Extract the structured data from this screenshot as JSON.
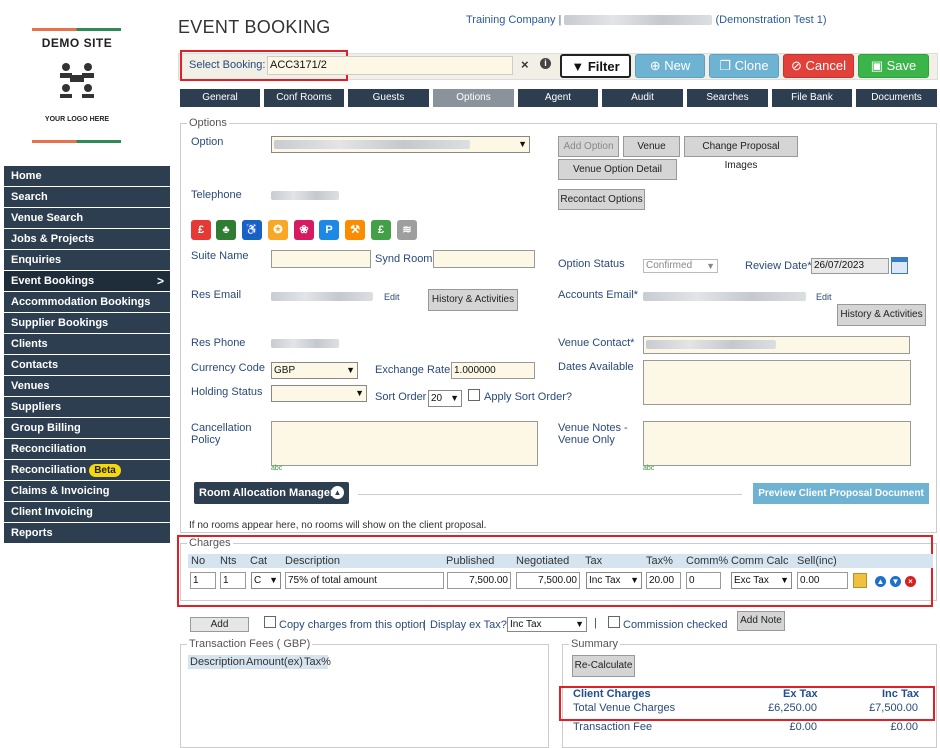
{
  "logo": {
    "site_name": "DEMO SITE",
    "tagline": "YOUR LOGO HERE"
  },
  "sidebar": {
    "items": [
      {
        "label": "Home"
      },
      {
        "label": "Search"
      },
      {
        "label": "Venue Search"
      },
      {
        "label": "Jobs & Projects"
      },
      {
        "label": "Enquiries"
      },
      {
        "label": "Event Bookings"
      },
      {
        "label": "Accommodation Bookings"
      },
      {
        "label": "Supplier Bookings"
      },
      {
        "label": "Clients"
      },
      {
        "label": "Contacts"
      },
      {
        "label": "Venues"
      },
      {
        "label": "Suppliers"
      },
      {
        "label": "Group Billing"
      },
      {
        "label": "Reconciliation"
      },
      {
        "label": "Reconciliation"
      },
      {
        "label": "Claims & Invoicing"
      },
      {
        "label": "Client Invoicing"
      },
      {
        "label": "Reports"
      }
    ],
    "beta_badge": "Beta",
    "active_chevron": ">"
  },
  "header": {
    "title": "EVENT BOOKING",
    "company_prefix": "Training Company |",
    "company_suffix": "(Demonstration Test 1)"
  },
  "booking_bar": {
    "select_label": "Select Booking:",
    "booking_ref": "ACC3171/2",
    "clear_symbol": "×",
    "info_symbol": "i",
    "filter_label": "Filter",
    "new_label": "New",
    "clone_label": "Clone",
    "cancel_label": "Cancel",
    "save_label": "Save"
  },
  "tabs": [
    {
      "label": "General"
    },
    {
      "label": "Conf Rooms"
    },
    {
      "label": "Guests"
    },
    {
      "label": "Options"
    },
    {
      "label": "Agent"
    },
    {
      "label": "Audit"
    },
    {
      "label": "Searches"
    },
    {
      "label": "File Bank"
    },
    {
      "label": "Documents"
    }
  ],
  "options": {
    "legend": "Options",
    "option_label": "Option",
    "telephone_label": "Telephone",
    "suite_name_label": "Suite Name",
    "synd_room_label": "Synd Room",
    "res_email_label": "Res Email",
    "edit_label": "Edit",
    "history_label": "History & Activities",
    "res_phone_label": "Res Phone",
    "currency_code_label": "Currency Code",
    "currency_code_value": "GBP",
    "exchange_rate_label": "Exchange Rate",
    "exchange_rate_value": "1.000000",
    "holding_status_label": "Holding Status",
    "sort_order_label": "Sort Order",
    "sort_order_value": "20",
    "apply_sort_label": "Apply Sort Order?",
    "cancellation_policy_label": "Cancellation Policy",
    "add_option_label": "Add Option",
    "venue_label": "Venue",
    "change_images_label": "Change Proposal Images",
    "venue_option_detail_label": "Venue Option Detail",
    "recontact_label": "Recontact Options",
    "option_status_label": "Option Status",
    "option_status_value": "Confirmed",
    "review_date_label": "Review Date*",
    "review_date_value": "26/07/2023",
    "accounts_email_label": "Accounts Email*",
    "venue_contact_label": "Venue Contact*",
    "dates_available_label": "Dates Available",
    "venue_notes_label": "Venue Notes - Venue Only",
    "spell_mark": "abc",
    "room_alloc_label": "Room Allocation Manager",
    "preview_label": "Preview Client Proposal Document",
    "no_rooms_note": "If no rooms appear here, no rooms will show on the client proposal."
  },
  "facility_icons": [
    {
      "name": "money-icon",
      "glyph": "£",
      "color": "#e53935"
    },
    {
      "name": "garden-icon",
      "glyph": "♣",
      "color": "#2e7d32"
    },
    {
      "name": "accessible-icon",
      "glyph": "♿",
      "color": "#1565c0"
    },
    {
      "name": "award-icon",
      "glyph": "✪",
      "color": "#f9a825"
    },
    {
      "name": "spa-icon",
      "glyph": "❀",
      "color": "#d81b60"
    },
    {
      "name": "parking-icon",
      "glyph": "P",
      "color": "#1e88e5"
    },
    {
      "name": "tools-icon",
      "glyph": "⚒",
      "color": "#fb8c00"
    },
    {
      "name": "pricing-icon",
      "glyph": "£",
      "color": "#43a047"
    },
    {
      "name": "wifi-icon",
      "glyph": "≋",
      "color": "#9e9e9e"
    }
  ],
  "charges": {
    "legend": "Charges",
    "headers": [
      "No",
      "Nts",
      "Cat",
      "Description",
      "Published",
      "Negotiated",
      "Tax",
      "Tax%",
      "Comm%",
      "Comm Calc",
      "Sell(inc)"
    ],
    "row": {
      "no": "1",
      "nts": "1",
      "cat": "C",
      "description": "75% of total amount",
      "published": "7,500.00",
      "negotiated": "7,500.00",
      "tax": "Inc Tax",
      "tax_pct": "20.00",
      "comm_pct": "0",
      "comm_calc": "Exc Tax",
      "sell_inc": "0.00"
    },
    "add_label": "Add",
    "copy_label": "Copy charges from this option",
    "display_ex_tax_label": "Display ex Tax?",
    "display_ex_tax_value": "Inc Tax",
    "separator": "|",
    "commission_checked_label": "Commission checked",
    "add_note_label": "Add Note"
  },
  "transaction_fees": {
    "legend": "Transaction Fees ( GBP)",
    "headers": [
      "Description",
      "Amount(ex)",
      "Tax%"
    ]
  },
  "summary": {
    "legend": "Summary",
    "recalc_label": "Re-Calculate",
    "client_charges_label": "Client Charges",
    "ex_tax_header": "Ex Tax",
    "inc_tax_header": "Inc Tax",
    "rows": [
      {
        "label": "Total Venue Charges",
        "ex": "£6,250.00",
        "inc": "£7,500.00"
      },
      {
        "label": "Transaction Fee",
        "ex": "£0.00",
        "inc": "£0.00"
      }
    ]
  }
}
